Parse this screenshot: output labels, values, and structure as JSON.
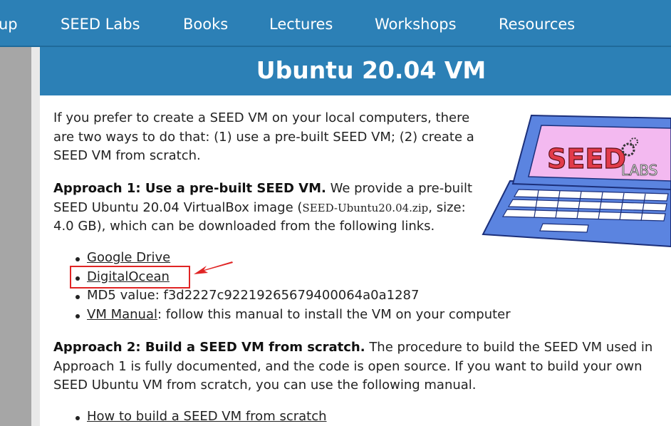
{
  "nav": {
    "items": [
      {
        "label": "up"
      },
      {
        "label": "SEED Labs"
      },
      {
        "label": "Books"
      },
      {
        "label": "Lectures"
      },
      {
        "label": "Workshops"
      },
      {
        "label": "Resources"
      }
    ]
  },
  "page": {
    "title": "Ubuntu 20.04 VM"
  },
  "intro": {
    "text": "If you prefer to create a SEED VM on your local computers, there are two ways to do that: (1) use a pre-built SEED VM; (2) create a SEED VM from scratch."
  },
  "approach1": {
    "heading": "Approach 1: Use a pre-built SEED VM.",
    "text_a": "We provide a pre-built SEED Ubuntu 20.04 VirtualBox image (",
    "filename": "SEED-Ubuntu20.04.zip",
    "text_b": ", size: 4.0 GB), which can be downloaded from the following links.",
    "links": {
      "google_drive": "Google Drive",
      "digitalocean": "DigitalOcean",
      "md5": "MD5 value: f3d2227c92219265679400064a0a1287",
      "vm_manual": "VM Manual",
      "vm_manual_suffix": ": follow this manual to install the VM on your computer"
    }
  },
  "approach2": {
    "heading": "Approach 2: Build a SEED VM from scratch.",
    "text": "The procedure to build the SEED VM used in Approach 1 is fully documented, and the code is open source. If you want to build your own SEED Ubuntu VM from scratch, you can use the following manual.",
    "link": "How to build a SEED VM from scratch"
  },
  "logo": {
    "word": "SEED",
    "word2": "LABS"
  },
  "colors": {
    "nav_bg": "#2c80b6",
    "highlight": "#e02424",
    "laptop_body": "#5b84e0"
  }
}
